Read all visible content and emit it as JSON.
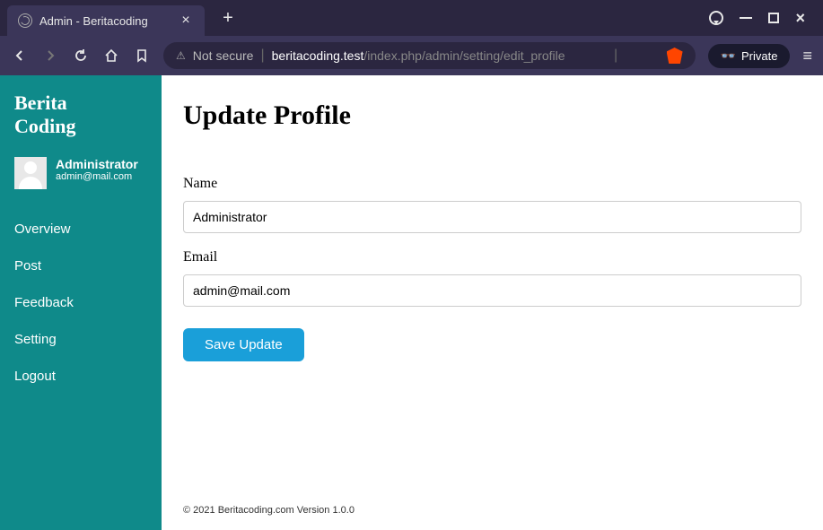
{
  "browser": {
    "tab_title": "Admin - Beritacoding",
    "not_secure_label": "Not secure",
    "url_domain": "beritacoding.test",
    "url_path": "/index.php/admin/setting/edit_profile",
    "private_label": "Private"
  },
  "sidebar": {
    "brand_line1": "Berita",
    "brand_line2": "Coding",
    "profile_name": "Administrator",
    "profile_email": "admin@mail.com",
    "items": [
      {
        "label": "Overview"
      },
      {
        "label": "Post"
      },
      {
        "label": "Feedback"
      },
      {
        "label": "Setting"
      },
      {
        "label": "Logout"
      }
    ]
  },
  "main": {
    "title": "Update Profile",
    "name_label": "Name",
    "name_value": "Administrator",
    "email_label": "Email",
    "email_value": "admin@mail.com",
    "save_button": "Save Update",
    "footer": "© 2021 Beritacoding.com Version 1.0.0"
  }
}
